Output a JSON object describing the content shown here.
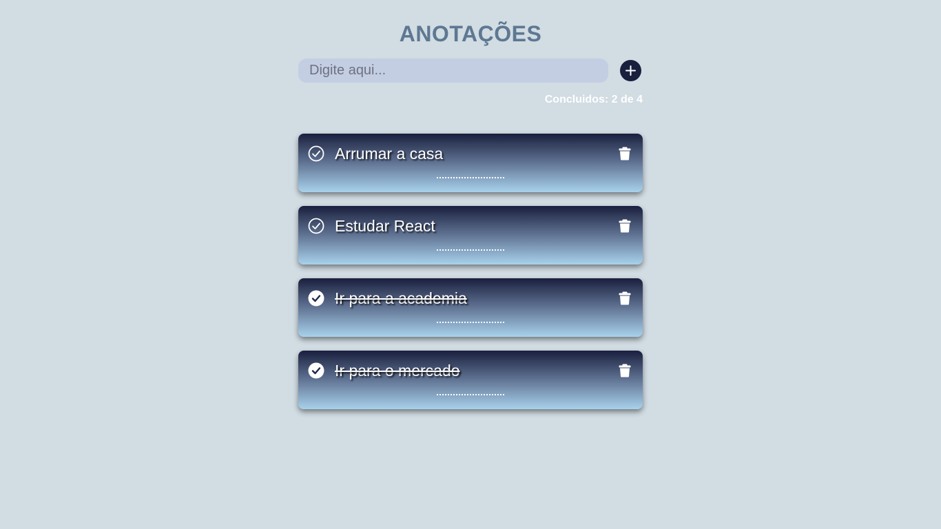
{
  "header": {
    "title": "ANOTAÇÕES"
  },
  "new_task": {
    "placeholder": "Digite aqui...",
    "value": "",
    "add_icon": "plus-icon"
  },
  "counter": {
    "text": "Concluidos: 2 de 4",
    "completed": 2,
    "total": 4
  },
  "tasks": [
    {
      "text": "Arrumar a casa",
      "completed": false
    },
    {
      "text": "Estudar React",
      "completed": false
    },
    {
      "text": "Ir para a academia",
      "completed": true
    },
    {
      "text": "Ir para o mercado",
      "completed": true
    }
  ],
  "icons": {
    "check": "check-circle-icon",
    "delete": "trash-icon"
  },
  "colors": {
    "background": "#d1dce3",
    "title": "#5e7892",
    "input_background": "#c4cee3",
    "add_button": "#18203e",
    "card_top": "#1a1f3e",
    "card_bottom": "#a8d2ec",
    "text": "#ffffff"
  }
}
